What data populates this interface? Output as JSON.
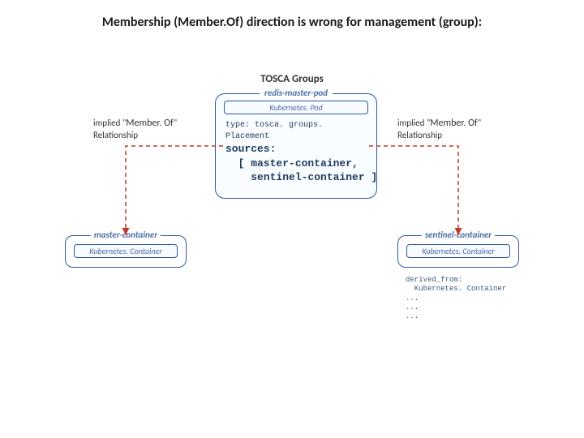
{
  "title": "Membership (Member.Of) direction is wrong for management (group):",
  "group_label": "TOSCA Groups",
  "pod": {
    "name": "redis-master-pod",
    "subtype": "Kubernetes. Pod",
    "type_line": "type: tosca. groups. Placement",
    "sources_label": "sources:",
    "sources_body": "  [ master-container,\n    sentinel-container ]"
  },
  "implied": {
    "prefix": "implied \"",
    "member_of": "Member. Of",
    "suffix": "\"",
    "line2": "Relationship"
  },
  "nodes": {
    "left": {
      "name": "master-container",
      "type": "Kubernetes. Container"
    },
    "right": {
      "name": "sentinel-container",
      "type": "Kubernetes. Container"
    }
  },
  "deriv": "derived_from:\n  Kubernetes. Container\n...\n...\n..."
}
